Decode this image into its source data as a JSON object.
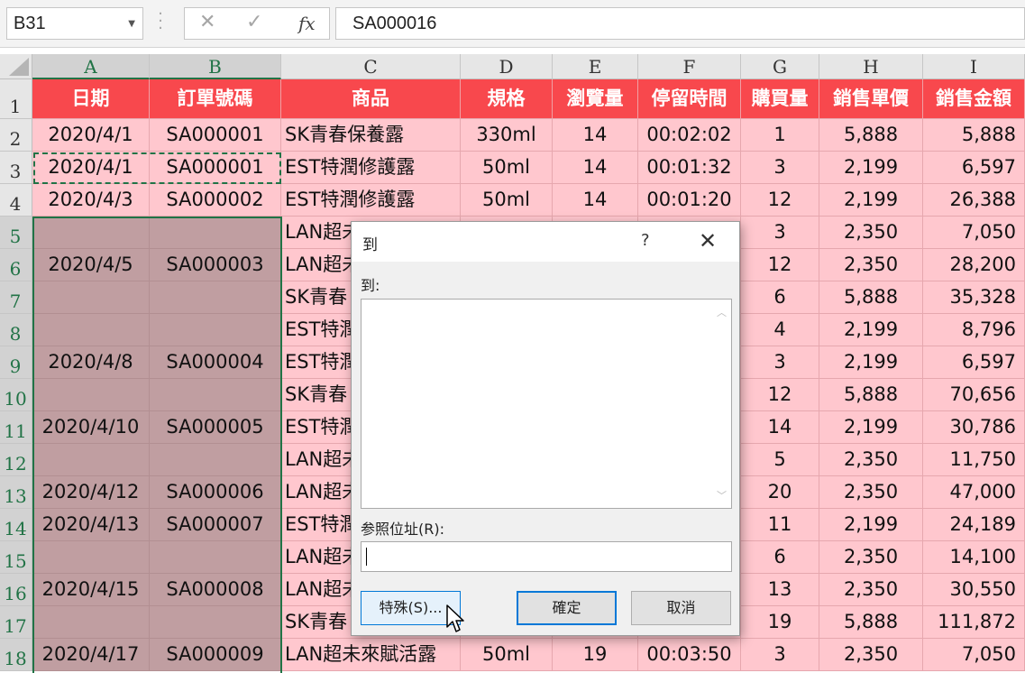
{
  "formula_bar": {
    "name_box": "B31",
    "name_box_arrow_icon": "chevron-down-icon",
    "cancel_icon": "close-icon",
    "enter_icon": "check-icon",
    "function_icon_label": "fx",
    "formula": "SA000016"
  },
  "columns": [
    "A",
    "B",
    "C",
    "D",
    "E",
    "F",
    "G",
    "H",
    "I"
  ],
  "rows": [
    "1",
    "2",
    "3",
    "4",
    "5",
    "6",
    "7",
    "8",
    "9",
    "10",
    "11",
    "12",
    "13",
    "14",
    "15",
    "16",
    "17",
    "18"
  ],
  "header_row": [
    "日期",
    "訂單號碼",
    "商品",
    "規格",
    "瀏覽量",
    "停留時間",
    "購買量",
    "銷售單價",
    "銷售金額"
  ],
  "data": {
    "r2": [
      "2020/4/1",
      "SA000001",
      "SK青春保養露",
      "330ml",
      "14",
      "00:02:02",
      "1",
      "5,888",
      "5,888"
    ],
    "r3": [
      "2020/4/1",
      "SA000001",
      "EST特潤修護露",
      "50ml",
      "14",
      "00:01:32",
      "3",
      "2,199",
      "6,597"
    ],
    "r4": [
      "2020/4/3",
      "SA000002",
      "EST特潤修護露",
      "50ml",
      "14",
      "00:01:20",
      "12",
      "2,199",
      "26,388"
    ],
    "r5": [
      "",
      "",
      "LAN超未",
      "",
      "",
      "",
      "3",
      "2,350",
      "7,050"
    ],
    "r6": [
      "2020/4/5",
      "SA000003",
      "LAN超未",
      "",
      "",
      "",
      "12",
      "2,350",
      "28,200"
    ],
    "r7": [
      "",
      "",
      "SK青春",
      "",
      "",
      "",
      "6",
      "5,888",
      "35,328"
    ],
    "r8": [
      "",
      "",
      "EST特潤",
      "",
      "",
      "",
      "4",
      "2,199",
      "8,796"
    ],
    "r9": [
      "2020/4/8",
      "SA000004",
      "EST特潤",
      "",
      "",
      "",
      "3",
      "2,199",
      "6,597"
    ],
    "r10": [
      "",
      "",
      "SK青春",
      "",
      "",
      "",
      "12",
      "5,888",
      "70,656"
    ],
    "r11": [
      "2020/4/10",
      "SA000005",
      "EST特潤",
      "",
      "",
      "",
      "14",
      "2,199",
      "30,786"
    ],
    "r12": [
      "",
      "",
      "LAN超未",
      "",
      "",
      "",
      "5",
      "2,350",
      "11,750"
    ],
    "r13": [
      "2020/4/12",
      "SA000006",
      "LAN超未",
      "",
      "",
      "",
      "20",
      "2,350",
      "47,000"
    ],
    "r14": [
      "2020/4/13",
      "SA000007",
      "EST特潤",
      "",
      "",
      "",
      "11",
      "2,199",
      "24,189"
    ],
    "r15": [
      "",
      "",
      "LAN超未",
      "",
      "",
      "",
      "6",
      "2,350",
      "14,100"
    ],
    "r16": [
      "2020/4/15",
      "SA000008",
      "LAN超未",
      "",
      "",
      "",
      "13",
      "2,350",
      "30,550"
    ],
    "r17": [
      "",
      "",
      "SK青春",
      "",
      "",
      "",
      "19",
      "5,888",
      "111,872"
    ],
    "r18": [
      "2020/4/17",
      "SA000009",
      "LAN超未來賦活露",
      "50ml",
      "19",
      "00:03:50",
      "3",
      "2,350",
      "7,050"
    ]
  },
  "dialog": {
    "title": "到",
    "help": "?",
    "goto_label": "到:",
    "reference_label": "参照位址(R):",
    "reference_value": "",
    "special_button": "特殊(S)...",
    "ok_button": "確定",
    "cancel_button": "取消"
  },
  "colors": {
    "header_fill": "#f8484d",
    "cell_fill": "#ffc7ce",
    "selected_fill": "#c09ea1",
    "selection_border": "#217346",
    "dialog_accent": "#0078d7"
  }
}
